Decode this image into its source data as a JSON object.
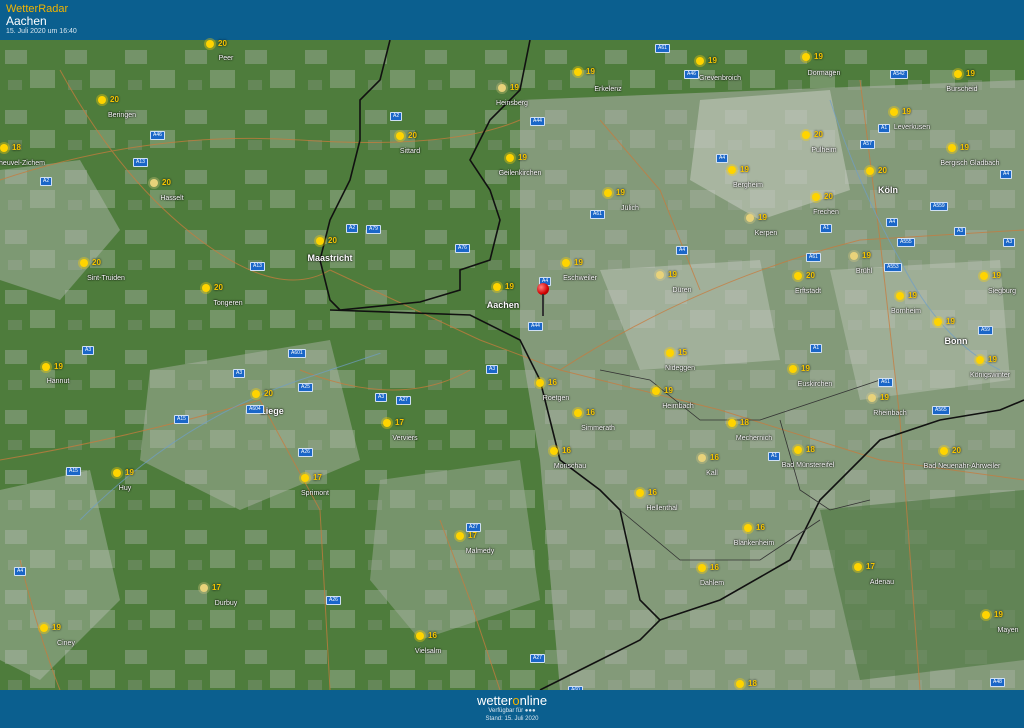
{
  "header": {
    "app_name": "WetterRadar",
    "location": "Aachen",
    "timestamp": "15. Juli 2020 um 16:40"
  },
  "footer": {
    "logo_pre": "wetter",
    "logo_o": "o",
    "logo_post": "nline",
    "available": "Verfügbar für",
    "stand": "Stand: 15. Juli 2020"
  },
  "marker": {
    "name": "location-pin",
    "place": "Aachen"
  },
  "cities": [
    {
      "name": "Peer",
      "temp": "20"
    },
    {
      "name": "Beringen",
      "temp": "20"
    },
    {
      "name": "Heusden-Zolder / Meeuwen-Zichem",
      "label": "heuvel-Zichem",
      "temp": "18"
    },
    {
      "name": "Hasselt",
      "temp": "20"
    },
    {
      "name": "Sint-Truiden",
      "temp": "20"
    },
    {
      "name": "Tongeren",
      "temp": "20"
    },
    {
      "name": "Hannut",
      "temp": "19"
    },
    {
      "name": "Liege",
      "temp": "20"
    },
    {
      "name": "Huy",
      "temp": "19"
    },
    {
      "name": "Sprimont",
      "temp": "17"
    },
    {
      "name": "Durbuy",
      "temp": "17"
    },
    {
      "name": "Ciney",
      "temp": "19"
    },
    {
      "name": "Vielsalm",
      "temp": "16"
    },
    {
      "name": "Malmedy",
      "temp": "17"
    },
    {
      "name": "Verviers",
      "temp": "17"
    },
    {
      "name": "Maastricht",
      "temp": "20"
    },
    {
      "name": "Sittard",
      "temp": "20"
    },
    {
      "name": "Heinsberg",
      "temp": "19"
    },
    {
      "name": "Geilenkirchen",
      "temp": "19"
    },
    {
      "name": "Aachen",
      "temp": "19"
    },
    {
      "name": "Eschweiler",
      "temp": "19"
    },
    {
      "name": "Erkelenz",
      "temp": "19"
    },
    {
      "name": "Grevenbroich",
      "temp": "19"
    },
    {
      "name": "Jülich",
      "label": "Jülich",
      "temp": "19"
    },
    {
      "name": "Düren",
      "label": "Düren",
      "temp": "19"
    },
    {
      "name": "Roetgen",
      "temp": "16"
    },
    {
      "name": "Simmerath",
      "temp": "16"
    },
    {
      "name": "Monschau",
      "temp": "16"
    },
    {
      "name": "Nideggen",
      "temp": "15"
    },
    {
      "name": "Heimbach",
      "temp": "19"
    },
    {
      "name": "Hellenthal",
      "temp": "16"
    },
    {
      "name": "Kall",
      "temp": "16"
    },
    {
      "name": "Dahlem",
      "temp": "16"
    },
    {
      "name": "Blankenheim",
      "temp": "16"
    },
    {
      "name": "Mechernich",
      "temp": "18"
    },
    {
      "name": "Bad Münstereifel",
      "label": "Bad Münstereifel",
      "temp": "18"
    },
    {
      "name": "Euskirchen",
      "temp": "19"
    },
    {
      "name": "Bergheim",
      "temp": "19"
    },
    {
      "name": "Kerpen",
      "temp": "19"
    },
    {
      "name": "Frechen",
      "temp": "20"
    },
    {
      "name": "Pulheim",
      "temp": "20"
    },
    {
      "name": "Dormagen",
      "temp": "19"
    },
    {
      "name": "Leverkusen",
      "temp": "19"
    },
    {
      "name": "Köln",
      "label": "Köln",
      "temp": "20"
    },
    {
      "name": "Erftstadt",
      "temp": "20"
    },
    {
      "name": "Brühl",
      "label": "Brühl",
      "temp": "19"
    },
    {
      "name": "Bornheim",
      "temp": "19"
    },
    {
      "name": "Bonn",
      "temp": "19"
    },
    {
      "name": "Burscheid",
      "temp": "19"
    },
    {
      "name": "Bergisch Gladbach",
      "temp": "19"
    },
    {
      "name": "Siegburg",
      "temp": "19"
    },
    {
      "name": "Königswinter",
      "temp": "19"
    },
    {
      "name": "Rheinbach",
      "temp": "19"
    },
    {
      "name": "Bad Neuenahr-Ahrweiler",
      "temp": "20"
    },
    {
      "name": "Adenau",
      "temp": "17"
    },
    {
      "name": "Mayen",
      "temp": "19"
    },
    {
      "name": "unnamed-bottom-1",
      "label": "",
      "temp": "18"
    }
  ],
  "highways": [
    "A61",
    "A46",
    "A57",
    "A542",
    "A1",
    "A2",
    "A13",
    "A2",
    "A76",
    "A79",
    "A2",
    "A46",
    "A44",
    "A61",
    "A4",
    "A4",
    "A61",
    "A553",
    "A1",
    "A3",
    "A1",
    "A4",
    "A559",
    "A555",
    "A4",
    "A3",
    "A59",
    "A13",
    "A3",
    "A601",
    "A3",
    "A25",
    "A27",
    "A3",
    "A15",
    "A604",
    "A26",
    "A27",
    "A4",
    "A26",
    "A27",
    "A60",
    "A15",
    "A1",
    "A61",
    "A565",
    "A48",
    "A44",
    "A4",
    "A3"
  ]
}
